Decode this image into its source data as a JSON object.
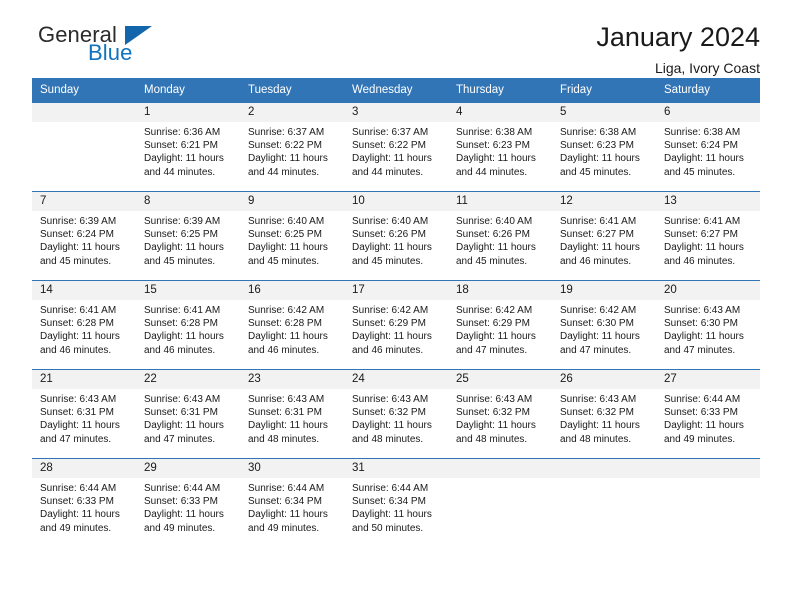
{
  "brand": {
    "name_part1": "General",
    "name_part2": "Blue",
    "accent_color": "#1073bd",
    "triangle_color": "#1366ab"
  },
  "header": {
    "title": "January 2024",
    "subtitle": "Liga, Ivory Coast"
  },
  "theme": {
    "header_blue": "#3275b6",
    "daynum_band": "#f2f2f2"
  },
  "calendar": {
    "weekday_headers": [
      "Sunday",
      "Monday",
      "Tuesday",
      "Wednesday",
      "Thursday",
      "Friday",
      "Saturday"
    ],
    "weeks": [
      [
        {
          "day": "",
          "empty": true,
          "sunrise": "",
          "sunset": "",
          "daylight_line1": "",
          "daylight_line2": ""
        },
        {
          "day": "1",
          "sunrise": "Sunrise: 6:36 AM",
          "sunset": "Sunset: 6:21 PM",
          "daylight_line1": "Daylight: 11 hours",
          "daylight_line2": "and 44 minutes."
        },
        {
          "day": "2",
          "sunrise": "Sunrise: 6:37 AM",
          "sunset": "Sunset: 6:22 PM",
          "daylight_line1": "Daylight: 11 hours",
          "daylight_line2": "and 44 minutes."
        },
        {
          "day": "3",
          "sunrise": "Sunrise: 6:37 AM",
          "sunset": "Sunset: 6:22 PM",
          "daylight_line1": "Daylight: 11 hours",
          "daylight_line2": "and 44 minutes."
        },
        {
          "day": "4",
          "sunrise": "Sunrise: 6:38 AM",
          "sunset": "Sunset: 6:23 PM",
          "daylight_line1": "Daylight: 11 hours",
          "daylight_line2": "and 44 minutes."
        },
        {
          "day": "5",
          "sunrise": "Sunrise: 6:38 AM",
          "sunset": "Sunset: 6:23 PM",
          "daylight_line1": "Daylight: 11 hours",
          "daylight_line2": "and 45 minutes."
        },
        {
          "day": "6",
          "sunrise": "Sunrise: 6:38 AM",
          "sunset": "Sunset: 6:24 PM",
          "daylight_line1": "Daylight: 11 hours",
          "daylight_line2": "and 45 minutes."
        }
      ],
      [
        {
          "day": "7",
          "sunrise": "Sunrise: 6:39 AM",
          "sunset": "Sunset: 6:24 PM",
          "daylight_line1": "Daylight: 11 hours",
          "daylight_line2": "and 45 minutes."
        },
        {
          "day": "8",
          "sunrise": "Sunrise: 6:39 AM",
          "sunset": "Sunset: 6:25 PM",
          "daylight_line1": "Daylight: 11 hours",
          "daylight_line2": "and 45 minutes."
        },
        {
          "day": "9",
          "sunrise": "Sunrise: 6:40 AM",
          "sunset": "Sunset: 6:25 PM",
          "daylight_line1": "Daylight: 11 hours",
          "daylight_line2": "and 45 minutes."
        },
        {
          "day": "10",
          "sunrise": "Sunrise: 6:40 AM",
          "sunset": "Sunset: 6:26 PM",
          "daylight_line1": "Daylight: 11 hours",
          "daylight_line2": "and 45 minutes."
        },
        {
          "day": "11",
          "sunrise": "Sunrise: 6:40 AM",
          "sunset": "Sunset: 6:26 PM",
          "daylight_line1": "Daylight: 11 hours",
          "daylight_line2": "and 45 minutes."
        },
        {
          "day": "12",
          "sunrise": "Sunrise: 6:41 AM",
          "sunset": "Sunset: 6:27 PM",
          "daylight_line1": "Daylight: 11 hours",
          "daylight_line2": "and 46 minutes."
        },
        {
          "day": "13",
          "sunrise": "Sunrise: 6:41 AM",
          "sunset": "Sunset: 6:27 PM",
          "daylight_line1": "Daylight: 11 hours",
          "daylight_line2": "and 46 minutes."
        }
      ],
      [
        {
          "day": "14",
          "sunrise": "Sunrise: 6:41 AM",
          "sunset": "Sunset: 6:28 PM",
          "daylight_line1": "Daylight: 11 hours",
          "daylight_line2": "and 46 minutes."
        },
        {
          "day": "15",
          "sunrise": "Sunrise: 6:41 AM",
          "sunset": "Sunset: 6:28 PM",
          "daylight_line1": "Daylight: 11 hours",
          "daylight_line2": "and 46 minutes."
        },
        {
          "day": "16",
          "sunrise": "Sunrise: 6:42 AM",
          "sunset": "Sunset: 6:28 PM",
          "daylight_line1": "Daylight: 11 hours",
          "daylight_line2": "and 46 minutes."
        },
        {
          "day": "17",
          "sunrise": "Sunrise: 6:42 AM",
          "sunset": "Sunset: 6:29 PM",
          "daylight_line1": "Daylight: 11 hours",
          "daylight_line2": "and 46 minutes."
        },
        {
          "day": "18",
          "sunrise": "Sunrise: 6:42 AM",
          "sunset": "Sunset: 6:29 PM",
          "daylight_line1": "Daylight: 11 hours",
          "daylight_line2": "and 47 minutes."
        },
        {
          "day": "19",
          "sunrise": "Sunrise: 6:42 AM",
          "sunset": "Sunset: 6:30 PM",
          "daylight_line1": "Daylight: 11 hours",
          "daylight_line2": "and 47 minutes."
        },
        {
          "day": "20",
          "sunrise": "Sunrise: 6:43 AM",
          "sunset": "Sunset: 6:30 PM",
          "daylight_line1": "Daylight: 11 hours",
          "daylight_line2": "and 47 minutes."
        }
      ],
      [
        {
          "day": "21",
          "sunrise": "Sunrise: 6:43 AM",
          "sunset": "Sunset: 6:31 PM",
          "daylight_line1": "Daylight: 11 hours",
          "daylight_line2": "and 47 minutes."
        },
        {
          "day": "22",
          "sunrise": "Sunrise: 6:43 AM",
          "sunset": "Sunset: 6:31 PM",
          "daylight_line1": "Daylight: 11 hours",
          "daylight_line2": "and 47 minutes."
        },
        {
          "day": "23",
          "sunrise": "Sunrise: 6:43 AM",
          "sunset": "Sunset: 6:31 PM",
          "daylight_line1": "Daylight: 11 hours",
          "daylight_line2": "and 48 minutes."
        },
        {
          "day": "24",
          "sunrise": "Sunrise: 6:43 AM",
          "sunset": "Sunset: 6:32 PM",
          "daylight_line1": "Daylight: 11 hours",
          "daylight_line2": "and 48 minutes."
        },
        {
          "day": "25",
          "sunrise": "Sunrise: 6:43 AM",
          "sunset": "Sunset: 6:32 PM",
          "daylight_line1": "Daylight: 11 hours",
          "daylight_line2": "and 48 minutes."
        },
        {
          "day": "26",
          "sunrise": "Sunrise: 6:43 AM",
          "sunset": "Sunset: 6:32 PM",
          "daylight_line1": "Daylight: 11 hours",
          "daylight_line2": "and 48 minutes."
        },
        {
          "day": "27",
          "sunrise": "Sunrise: 6:44 AM",
          "sunset": "Sunset: 6:33 PM",
          "daylight_line1": "Daylight: 11 hours",
          "daylight_line2": "and 49 minutes."
        }
      ],
      [
        {
          "day": "28",
          "sunrise": "Sunrise: 6:44 AM",
          "sunset": "Sunset: 6:33 PM",
          "daylight_line1": "Daylight: 11 hours",
          "daylight_line2": "and 49 minutes."
        },
        {
          "day": "29",
          "sunrise": "Sunrise: 6:44 AM",
          "sunset": "Sunset: 6:33 PM",
          "daylight_line1": "Daylight: 11 hours",
          "daylight_line2": "and 49 minutes."
        },
        {
          "day": "30",
          "sunrise": "Sunrise: 6:44 AM",
          "sunset": "Sunset: 6:34 PM",
          "daylight_line1": "Daylight: 11 hours",
          "daylight_line2": "and 49 minutes."
        },
        {
          "day": "31",
          "sunrise": "Sunrise: 6:44 AM",
          "sunset": "Sunset: 6:34 PM",
          "daylight_line1": "Daylight: 11 hours",
          "daylight_line2": "and 50 minutes."
        },
        {
          "day": "",
          "empty": true,
          "sunrise": "",
          "sunset": "",
          "daylight_line1": "",
          "daylight_line2": ""
        },
        {
          "day": "",
          "empty": true,
          "sunrise": "",
          "sunset": "",
          "daylight_line1": "",
          "daylight_line2": ""
        },
        {
          "day": "",
          "empty": true,
          "sunrise": "",
          "sunset": "",
          "daylight_line1": "",
          "daylight_line2": ""
        }
      ]
    ]
  }
}
